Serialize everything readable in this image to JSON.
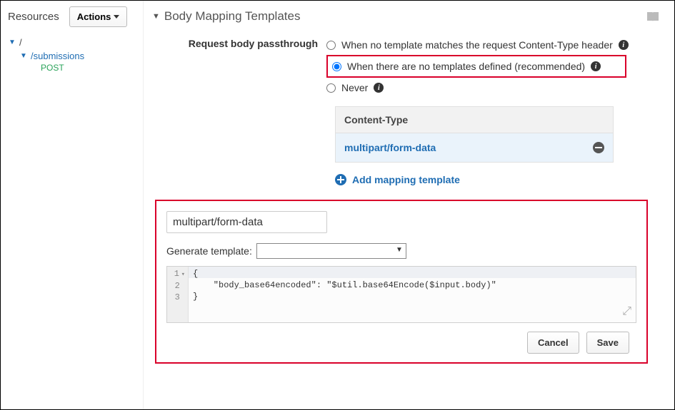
{
  "sidebar": {
    "title": "Resources",
    "actions_label": "Actions",
    "tree": {
      "root": "/",
      "child": "/submissions",
      "method": "POST"
    }
  },
  "section": {
    "title": "Body Mapping Templates"
  },
  "passthrough": {
    "label": "Request body passthrough",
    "options": [
      "When no template matches the request Content-Type header",
      "When there are no templates defined (recommended)",
      "Never"
    ],
    "selected_index": 1
  },
  "content_type_table": {
    "header": "Content-Type",
    "row_value": "multipart/form-data"
  },
  "add_template_label": "Add mapping template",
  "editor": {
    "content_type_input": "multipart/form-data",
    "generate_label": "Generate template:",
    "code_lines": [
      "{",
      "    \"body_base64encoded\": \"$util.base64Encode($input.body)\"",
      "}"
    ],
    "cancel_label": "Cancel",
    "save_label": "Save"
  }
}
